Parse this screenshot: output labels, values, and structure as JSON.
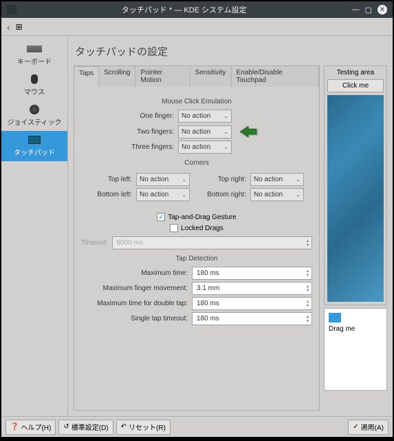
{
  "window": {
    "title": "タッチパッド * — KDE システム設定"
  },
  "sidebar": {
    "items": [
      {
        "label": "キーボード"
      },
      {
        "label": "マウス"
      },
      {
        "label": "ジョイスティック"
      },
      {
        "label": "タッチパッド"
      }
    ]
  },
  "page": {
    "title": "タッチパッドの設定"
  },
  "tabs": [
    {
      "label": "Taps"
    },
    {
      "label": "Scrolling"
    },
    {
      "label": "Pointer Motion"
    },
    {
      "label": "Sensitivity"
    },
    {
      "label": "Enable/Disable Touchpad"
    }
  ],
  "emulation": {
    "title": "Mouse Click Emulation",
    "one_label": "One finger:",
    "two_label": "Two fingers:",
    "three_label": "Three fingers:",
    "no_action": "No action"
  },
  "corners": {
    "title": "Corners",
    "tl_label": "Top left:",
    "tr_label": "Top right:",
    "bl_label": "Bottom left:",
    "br_label": "Bottom right:",
    "no_action": "No action"
  },
  "gesture": {
    "tap_drag": "Tap-and-Drag Gesture",
    "locked": "Locked Drags",
    "timeout_label": "Timeout:",
    "timeout_value": "5000 ms"
  },
  "detection": {
    "title": "Tap Detection",
    "max_time_label": "Maximum time:",
    "max_time_value": "180 ms",
    "max_move_label": "Maximum finger movement:",
    "max_move_value": "3.1 mm",
    "max_double_label": "Maximum time for double tap:",
    "max_double_value": "180 ms",
    "single_label": "Single tap timeout:",
    "single_value": "180 ms"
  },
  "testing": {
    "title": "Testing area",
    "click_me": "Click me",
    "drag_me": "Drag me"
  },
  "footer": {
    "help": "ヘルプ(H)",
    "defaults": "標準設定(D)",
    "reset": "リセット(R)",
    "apply": "適用(A)"
  }
}
